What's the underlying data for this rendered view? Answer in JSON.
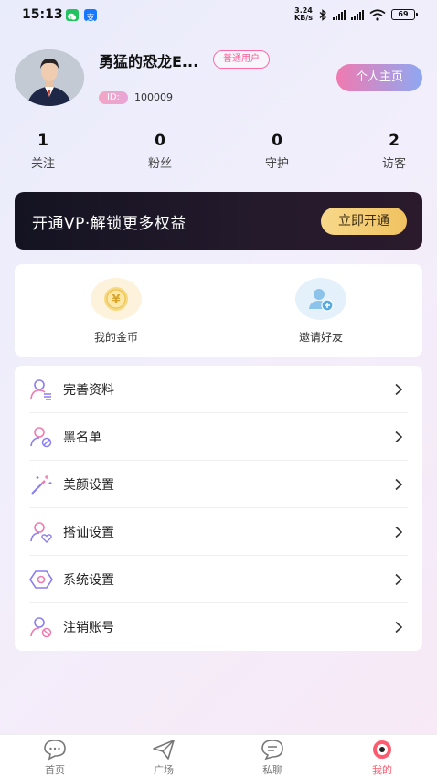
{
  "status_bar": {
    "time": "15:13",
    "net_speed_value": "3.24",
    "net_speed_unit": "KB/s",
    "battery": "69"
  },
  "profile": {
    "username": "勇猛的恐龙E...",
    "badge": "普通用户",
    "id_label": "ID:",
    "id_value": "100009",
    "home_button": "个人主页"
  },
  "stats": [
    {
      "value": "1",
      "label": "关注"
    },
    {
      "value": "0",
      "label": "粉丝"
    },
    {
      "value": "0",
      "label": "守护"
    },
    {
      "value": "2",
      "label": "访客"
    }
  ],
  "vip": {
    "text": "开通VP·解锁更多权益",
    "button": "立即开通"
  },
  "quick_actions": [
    {
      "label": "我的金币",
      "icon": "coin-icon"
    },
    {
      "label": "邀请好友",
      "icon": "invite-friend-icon"
    }
  ],
  "menu": [
    {
      "label": "完善资料",
      "icon": "edit-profile-icon"
    },
    {
      "label": "黑名单",
      "icon": "blacklist-icon"
    },
    {
      "label": "美颜设置",
      "icon": "magic-wand-icon"
    },
    {
      "label": "搭讪设置",
      "icon": "user-heart-icon"
    },
    {
      "label": "系统设置",
      "icon": "hexagon-settings-icon"
    },
    {
      "label": "注销账号",
      "icon": "cancel-account-icon"
    }
  ],
  "tabs": [
    {
      "label": "首页",
      "icon": "chat-bubble-icon"
    },
    {
      "label": "广场",
      "icon": "paper-plane-icon"
    },
    {
      "label": "私聊",
      "icon": "message-icon"
    },
    {
      "label": "我的",
      "icon": "profile-icon"
    }
  ],
  "colors": {
    "accent_pink": "#ff5a95",
    "tab_active": "#ff5a6e",
    "vip_gold": "#f0c260",
    "icon_purple": "#8a7ff0",
    "icon_pink": "#f07ab0"
  }
}
